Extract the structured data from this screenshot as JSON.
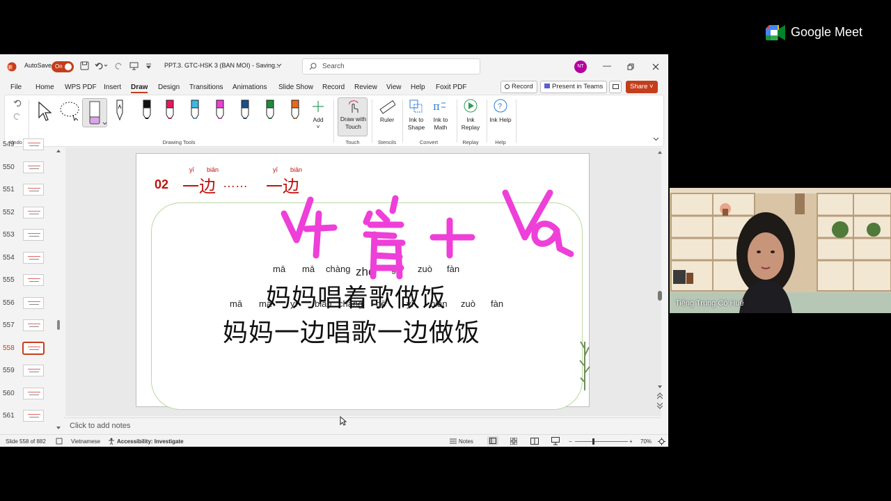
{
  "titlebar": {
    "autosave_label": "AutoSave",
    "autosave_state": "On",
    "doc_title": "PPT.3. GTC-HSK 3 (BAN MOI) - Saving...",
    "search_placeholder": "Search",
    "user_initials": "NT"
  },
  "menu": {
    "items": [
      "File",
      "Home",
      "WPS PDF",
      "Insert",
      "Draw",
      "Design",
      "Transitions",
      "Animations",
      "Slide Show",
      "Record",
      "Review",
      "View",
      "Help",
      "Foxit PDF"
    ],
    "active": "Draw",
    "record_label": "Record",
    "present_label": "Present in Teams",
    "share_label": "Share"
  },
  "ribbon": {
    "undo_group": "Undo",
    "drawing_tools_group": "Drawing Tools",
    "add_label": "Add",
    "draw_with_touch": "Draw with Touch",
    "touch_group": "Touch",
    "ruler": "Ruler",
    "stencils_group": "Stencils",
    "ink_to_shape": "Ink to Shape",
    "ink_to_math": "Ink to Math",
    "convert_group": "Convert",
    "ink_replay": "Ink Replay",
    "replay_group": "Replay",
    "ink_help": "Ink Help",
    "help_group": "Help",
    "pen_colors": [
      "#111111",
      "#e8175d",
      "#3db7e4",
      "#ee3fd8",
      "#1a4f8b",
      "#1e8c3a",
      "#e76a1b"
    ]
  },
  "thumbnails": {
    "numbers": [
      "549",
      "550",
      "551",
      "552",
      "553",
      "554",
      "555",
      "556",
      "557",
      "558",
      "559",
      "560",
      "561"
    ],
    "selected": "558"
  },
  "slide": {
    "section_number": "02",
    "heading_pinyin_1": "yī",
    "heading_pinyin_2": "biān",
    "heading_pinyin_3": "yī",
    "heading_pinyin_4": "biān",
    "heading_text_1": "一边",
    "heading_dots": "……",
    "heading_text_2": "一边",
    "line1_pinyin": [
      "mā",
      "mā",
      "chàng",
      "zhe",
      "gē",
      "zuò",
      "fàn"
    ],
    "line1_text": "妈妈唱着歌做饭",
    "line2_pinyin": [
      "mā",
      "mā",
      "yī",
      "biān",
      "chàng",
      "gē",
      "yī",
      "biān",
      "zuò",
      "fàn"
    ],
    "line2_text": "妈妈一边唱歌一边做饭",
    "ink_color": "#ee3fd8"
  },
  "notes_placeholder": "Click to add notes",
  "status": {
    "slide_info": "Slide 558 of 882",
    "language": "Vietnamese",
    "accessibility": "Accessibility: Investigate",
    "notes_label": "Notes",
    "zoom": "70%"
  },
  "meet": {
    "brand": "Google Meet",
    "participant_name": "Tiếng Trung Cô Huế"
  }
}
